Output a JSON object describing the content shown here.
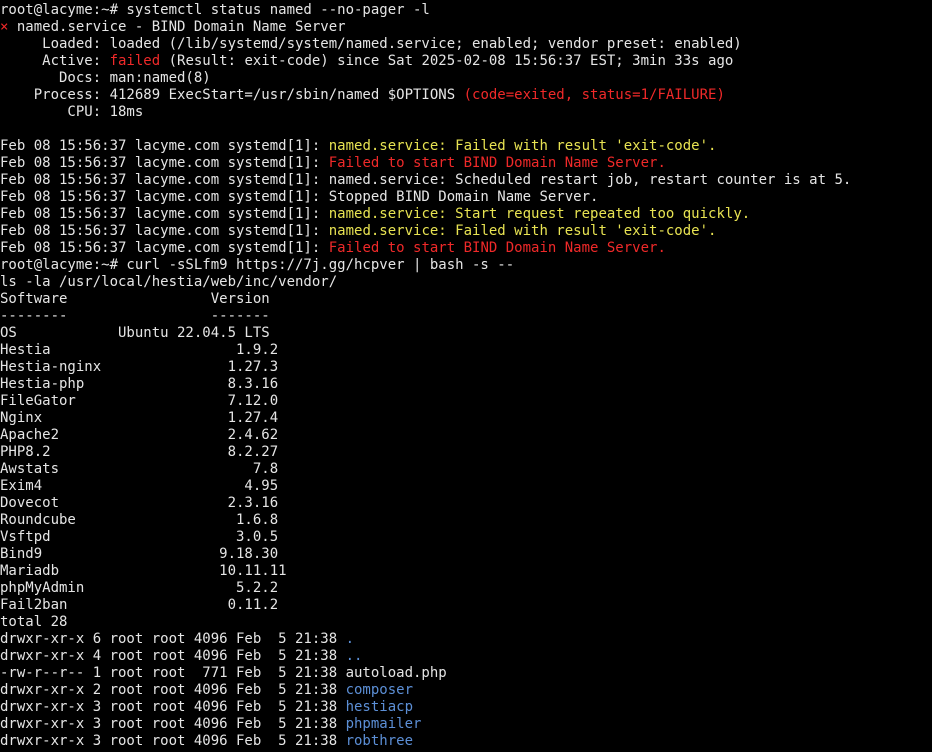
{
  "terminal": {
    "colors": {
      "background": "#000000",
      "text": "#e5e5e5",
      "error": "#ef2929",
      "warning": "#e8e352",
      "directory": "#5c8fd6"
    },
    "lines": [
      [
        {
          "text": "root@lacyme:~# systemctl status named --no-pager -l",
          "color": "white"
        }
      ],
      [
        {
          "text": "×",
          "color": "red"
        },
        {
          "text": " named.service - BIND Domain Name Server",
          "color": "white"
        }
      ],
      [
        {
          "text": "     Loaded: loaded (/lib/systemd/system/named.service; enabled; vendor preset: enabled)",
          "color": "white"
        }
      ],
      [
        {
          "text": "     Active: ",
          "color": "white"
        },
        {
          "text": "failed",
          "color": "red"
        },
        {
          "text": " (Result: exit-code) since Sat 2025-02-08 15:56:37 EST; 3min 33s ago",
          "color": "white"
        }
      ],
      [
        {
          "text": "       Docs: man:named(8)",
          "color": "white"
        }
      ],
      [
        {
          "text": "    Process: 412689 ExecStart=/usr/sbin/named $OPTIONS ",
          "color": "white"
        },
        {
          "text": "(code=exited, status=1/FAILURE)",
          "color": "red"
        }
      ],
      [
        {
          "text": "        CPU: 18ms",
          "color": "white"
        }
      ],
      [
        {
          "text": "",
          "color": "white"
        }
      ],
      [
        {
          "text": "Feb 08 15:56:37 lacyme.com systemd[1]: ",
          "color": "white"
        },
        {
          "text": "named.service: Failed with result 'exit-code'.",
          "color": "yellow"
        }
      ],
      [
        {
          "text": "Feb 08 15:56:37 lacyme.com systemd[1]: ",
          "color": "white"
        },
        {
          "text": "Failed to start BIND Domain Name Server.",
          "color": "red"
        }
      ],
      [
        {
          "text": "Feb 08 15:56:37 lacyme.com systemd[1]: named.service: Scheduled restart job, restart counter is at 5.",
          "color": "white"
        }
      ],
      [
        {
          "text": "Feb 08 15:56:37 lacyme.com systemd[1]: Stopped BIND Domain Name Server.",
          "color": "white"
        }
      ],
      [
        {
          "text": "Feb 08 15:56:37 lacyme.com systemd[1]: ",
          "color": "white"
        },
        {
          "text": "named.service: Start request repeated too quickly.",
          "color": "yellow"
        }
      ],
      [
        {
          "text": "Feb 08 15:56:37 lacyme.com systemd[1]: ",
          "color": "white"
        },
        {
          "text": "named.service: Failed with result 'exit-code'.",
          "color": "yellow"
        }
      ],
      [
        {
          "text": "Feb 08 15:56:37 lacyme.com systemd[1]: ",
          "color": "white"
        },
        {
          "text": "Failed to start BIND Domain Name Server.",
          "color": "red"
        }
      ],
      [
        {
          "text": "root@lacyme:~# curl -sSLfm9 https://7j.gg/hcpver | bash -s --",
          "color": "white"
        }
      ],
      [
        {
          "text": "ls -la /usr/local/hestia/web/inc/vendor/",
          "color": "white"
        }
      ],
      [
        {
          "text": "Software                 Version",
          "color": "white"
        }
      ],
      [
        {
          "text": "--------                 -------",
          "color": "white"
        }
      ],
      [
        {
          "text": "OS            Ubuntu 22.04.5 LTS",
          "color": "white"
        }
      ],
      [
        {
          "text": "Hestia                      1.9.2",
          "color": "white"
        }
      ],
      [
        {
          "text": "Hestia-nginx               1.27.3",
          "color": "white"
        }
      ],
      [
        {
          "text": "Hestia-php                 8.3.16",
          "color": "white"
        }
      ],
      [
        {
          "text": "FileGator                  7.12.0",
          "color": "white"
        }
      ],
      [
        {
          "text": "Nginx                      1.27.4",
          "color": "white"
        }
      ],
      [
        {
          "text": "Apache2                    2.4.62",
          "color": "white"
        }
      ],
      [
        {
          "text": "PHP8.2                     8.2.27",
          "color": "white"
        }
      ],
      [
        {
          "text": "Awstats                       7.8",
          "color": "white"
        }
      ],
      [
        {
          "text": "Exim4                        4.95",
          "color": "white"
        }
      ],
      [
        {
          "text": "Dovecot                    2.3.16",
          "color": "white"
        }
      ],
      [
        {
          "text": "Roundcube                   1.6.8",
          "color": "white"
        }
      ],
      [
        {
          "text": "Vsftpd                      3.0.5",
          "color": "white"
        }
      ],
      [
        {
          "text": "Bind9                     9.18.30",
          "color": "white"
        }
      ],
      [
        {
          "text": "Mariadb                   10.11.11",
          "color": "white"
        }
      ],
      [
        {
          "text": "phpMyAdmin                  5.2.2",
          "color": "white"
        }
      ],
      [
        {
          "text": "Fail2ban                   0.11.2",
          "color": "white"
        }
      ],
      [
        {
          "text": "total 28",
          "color": "white"
        }
      ],
      [
        {
          "text": "drwxr-xr-x 6 root root 4096 Feb  5 21:38 ",
          "color": "white"
        },
        {
          "text": ".",
          "color": "blue"
        }
      ],
      [
        {
          "text": "drwxr-xr-x 4 root root 4096 Feb  5 21:38 ",
          "color": "white"
        },
        {
          "text": "..",
          "color": "blue"
        }
      ],
      [
        {
          "text": "-rw-r--r-- 1 root root  771 Feb  5 21:38 autoload.php",
          "color": "white"
        }
      ],
      [
        {
          "text": "drwxr-xr-x 2 root root 4096 Feb  5 21:38 ",
          "color": "white"
        },
        {
          "text": "composer",
          "color": "blue"
        }
      ],
      [
        {
          "text": "drwxr-xr-x 3 root root 4096 Feb  5 21:38 ",
          "color": "white"
        },
        {
          "text": "hestiacp",
          "color": "blue"
        }
      ],
      [
        {
          "text": "drwxr-xr-x 3 root root 4096 Feb  5 21:38 ",
          "color": "white"
        },
        {
          "text": "phpmailer",
          "color": "blue"
        }
      ],
      [
        {
          "text": "drwxr-xr-x 3 root root 4096 Feb  5 21:38 ",
          "color": "white"
        },
        {
          "text": "robthree",
          "color": "blue"
        }
      ]
    ]
  }
}
